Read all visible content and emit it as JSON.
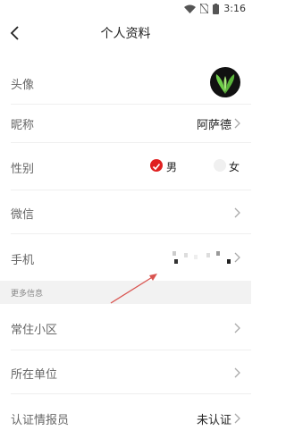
{
  "status_bar": {
    "time": "3:16",
    "icons": [
      "wifi-icon",
      "no-sim-icon",
      "battery-icon"
    ]
  },
  "header": {
    "title": "个人资料",
    "back_icon": "chevron-left-icon"
  },
  "rows": {
    "avatar": {
      "label": "头像"
    },
    "nickname": {
      "label": "昵称",
      "value": "阿萨德"
    },
    "gender": {
      "label": "性别",
      "male": "男",
      "female": "女",
      "selected": "男"
    },
    "wechat": {
      "label": "微信"
    },
    "phone": {
      "label": "手机"
    }
  },
  "more_section": {
    "title": "更多信息"
  },
  "more_rows": {
    "community": {
      "label": "常住小区"
    },
    "workplace": {
      "label": "所在单位"
    },
    "verification": {
      "label": "认证情报员",
      "value": "未认证"
    }
  },
  "colors": {
    "accent": "#e02020",
    "label": "#666666",
    "divider": "#efefef",
    "section_bg": "#f2f2f2",
    "arrow": "#d9534f"
  }
}
